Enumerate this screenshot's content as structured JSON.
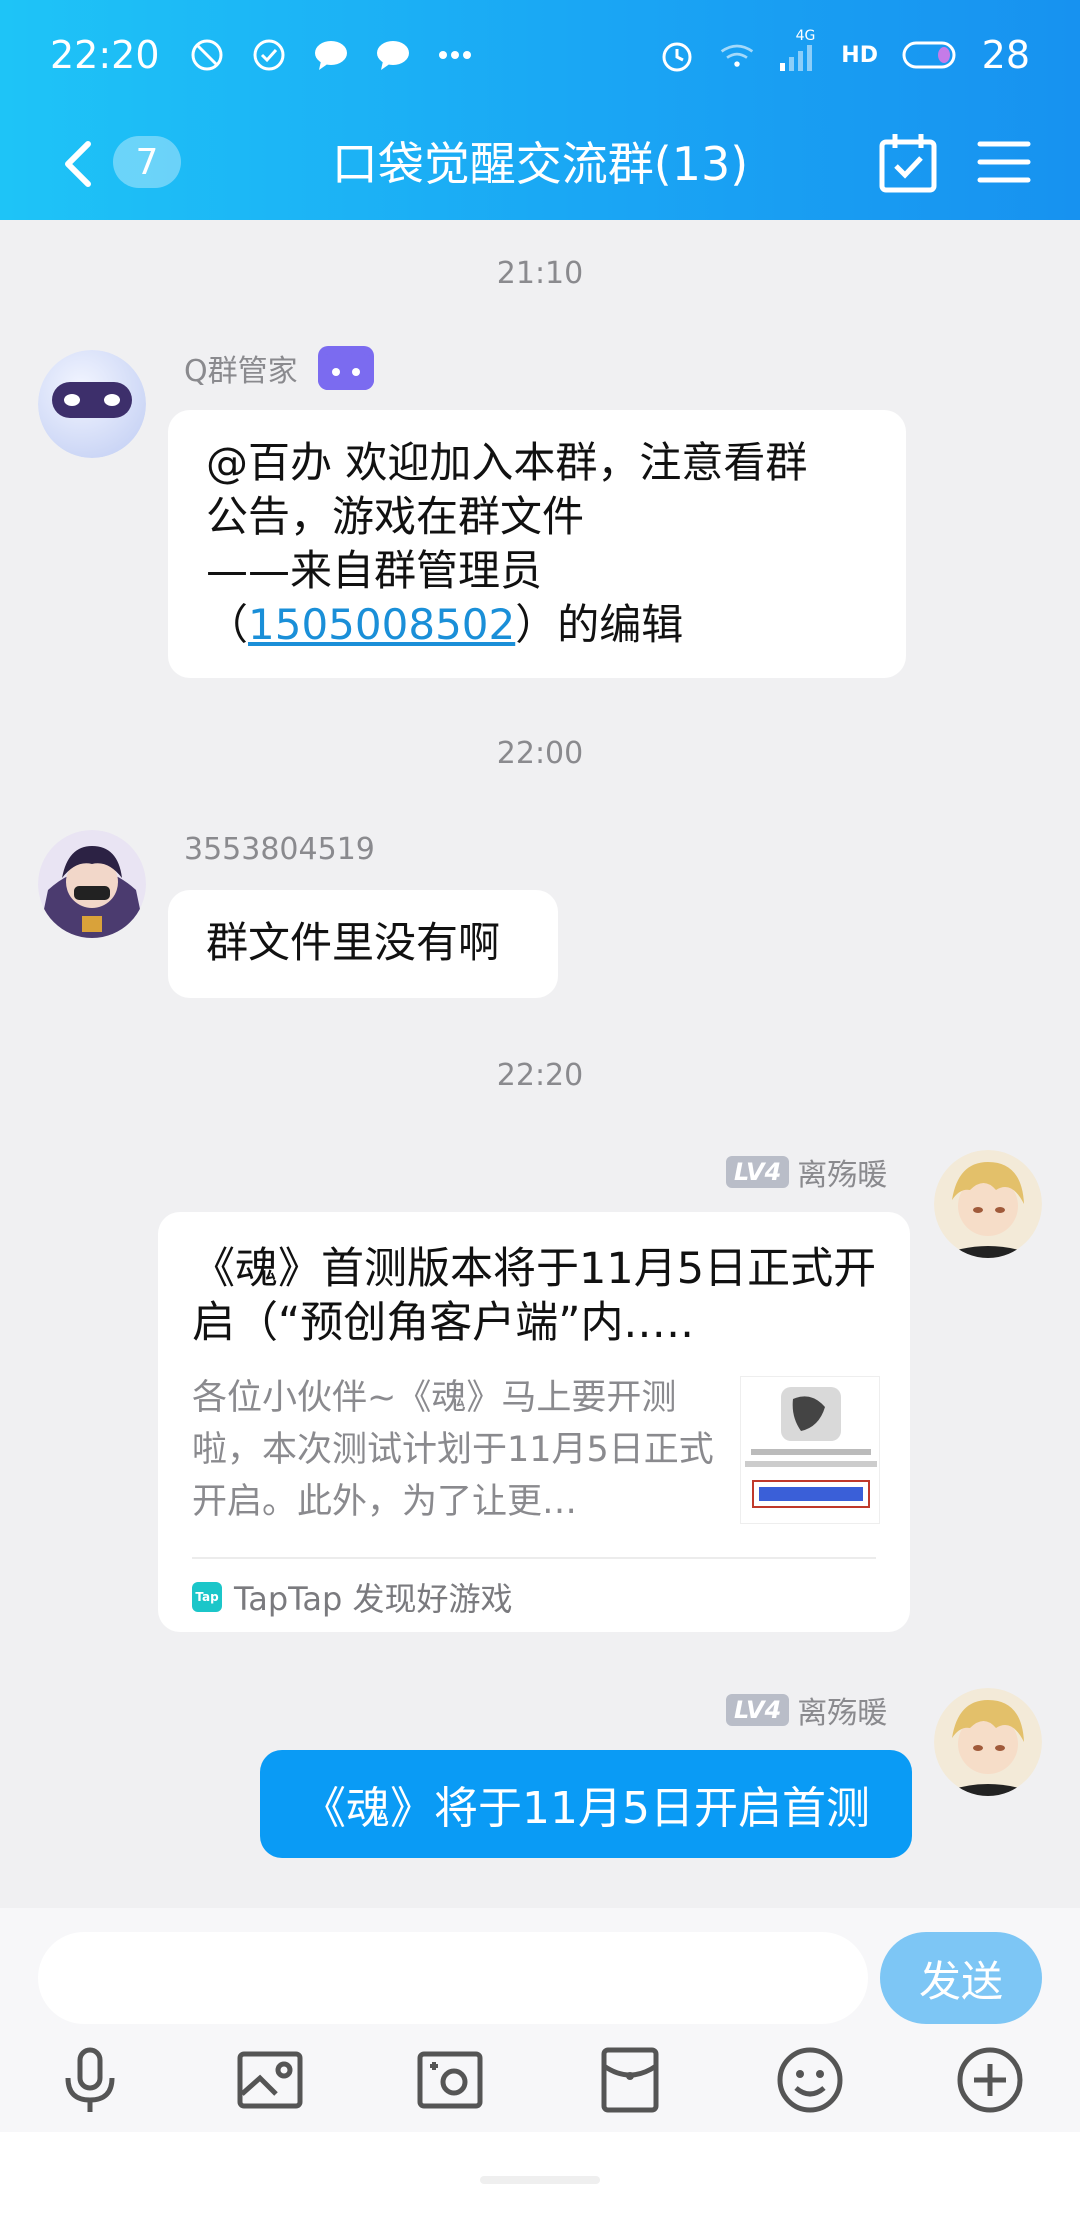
{
  "status_bar": {
    "time": "22:20",
    "battery": "28",
    "network": "4G",
    "hd": "HD"
  },
  "nav": {
    "unread_count": "7",
    "title": "口袋觉醒交流群(13)"
  },
  "messages": {
    "ts1": "21:10",
    "bot_name": "Q群管家",
    "bot_line1": "@百办 欢迎加入本群，注意看群",
    "bot_line2": "公告，游戏在群文件",
    "bot_line3": "——来自群管理员",
    "bot_line4_pre": "（",
    "bot_link": "1505008502",
    "bot_line4_post": "）的编辑",
    "ts2": "22:00",
    "user2_name": "3553804519",
    "user2_text": "群文件里没有啊",
    "ts3": "22:20",
    "me_level": "LV4",
    "me_name": "离殇暖",
    "card_title": "《魂》首测版本将于11月5日正式开启（“预创角客户端”内.….",
    "card_desc": "各位小伙伴~《魂》马上要开测啦，本次测试计划于11月5日正式开启。此外，为了让更…",
    "card_source": "TapTap 发现好游戏",
    "card_logo": "Tap",
    "my_text": "《魂》将于11月5日开启首测"
  },
  "input": {
    "placeholder": "",
    "send_label": "发送"
  },
  "colors": {
    "header_gradient_start": "#1ec4f7",
    "header_gradient_end": "#1792f0",
    "my_bubble": "#0a9bf5",
    "send_button": "#7dc6f5",
    "link": "#1a8fd8"
  }
}
